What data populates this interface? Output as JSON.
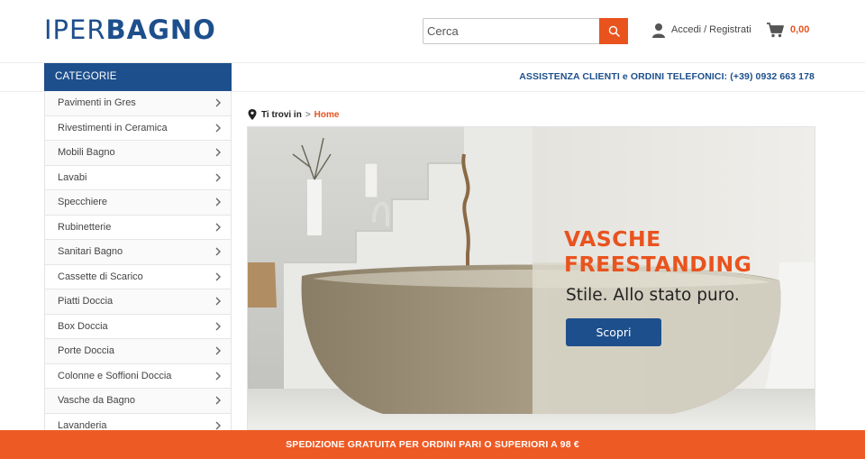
{
  "header": {
    "logo_part1": "IPER",
    "logo_part2": "BAGNO",
    "search_placeholder": "Cerca",
    "login_label": "Accedi / Registrati",
    "cart_total": "0,00"
  },
  "categories_title": "CATEGORIE",
  "assistance": "ASSISTENZA CLIENTI e ORDINI TELEFONICI: (+39) 0932 663 178",
  "sidebar": {
    "items": [
      {
        "label": "Pavimenti in Gres"
      },
      {
        "label": "Rivestimenti in Ceramica"
      },
      {
        "label": "Mobili Bagno"
      },
      {
        "label": "Lavabi"
      },
      {
        "label": "Specchiere"
      },
      {
        "label": "Rubinetterie"
      },
      {
        "label": "Sanitari Bagno"
      },
      {
        "label": "Cassette di Scarico"
      },
      {
        "label": "Piatti Doccia"
      },
      {
        "label": "Box Doccia"
      },
      {
        "label": "Porte Doccia"
      },
      {
        "label": "Colonne e Soffioni Doccia"
      },
      {
        "label": "Vasche da Bagno"
      },
      {
        "label": "Lavanderia"
      }
    ]
  },
  "breadcrumb": {
    "label": "Ti trovi in",
    "separator": ">",
    "home": "Home"
  },
  "banner": {
    "title_line1": "VASCHE",
    "title_line2": "FREESTANDING",
    "subtitle": "Stile. Allo stato puro.",
    "button": "Scopri"
  },
  "shipping_bar": "SPEDIZIONE GRATUITA PER ORDINI PARI O SUPERIORI A 98 €",
  "colors": {
    "brand_blue": "#1d4f8c",
    "accent_orange": "#e9531e"
  }
}
